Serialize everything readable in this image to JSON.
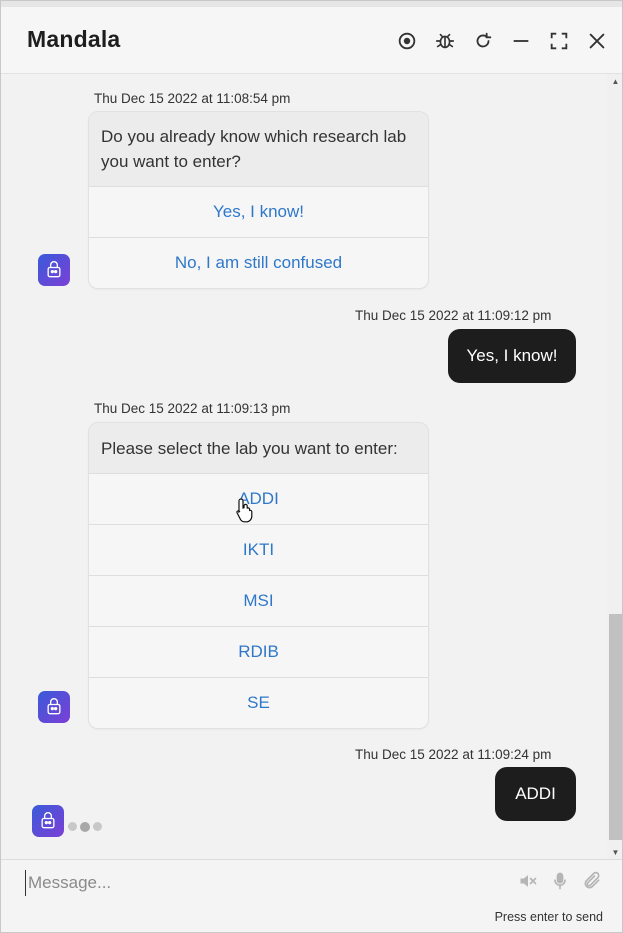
{
  "header": {
    "title": "Mandala",
    "icons": [
      "record-icon",
      "bug-icon",
      "refresh-icon",
      "minimize-icon",
      "fullscreen-icon",
      "close-icon"
    ]
  },
  "messages": {
    "m1": {
      "timestamp": "Thu Dec 15 2022 at 11:08:54 pm",
      "question": "Do you already know which research lab you want to enter?",
      "options": [
        "Yes, I know!",
        "No, I am still confused"
      ]
    },
    "m2": {
      "timestamp": "Thu Dec 15 2022 at 11:09:12 pm",
      "text": "Yes, I know!"
    },
    "m3": {
      "timestamp": "Thu Dec 15 2022 at 11:09:13 pm",
      "question": "Please select the lab you want to enter:",
      "options": [
        "ADDI",
        "IKTI",
        "MSI",
        "RDIB",
        "SE"
      ]
    },
    "m4": {
      "timestamp": "Thu Dec 15 2022 at 11:09:24 pm",
      "text": "ADDI"
    }
  },
  "footer": {
    "placeholder": "Message...",
    "hint": "Press enter to send",
    "icons": [
      "mute-icon",
      "microphone-icon",
      "attachment-icon"
    ]
  },
  "colors": {
    "accent_link": "#2f78c9",
    "user_bubble": "#1d1d1d",
    "avatar_gradient_start": "#3a5bd9",
    "avatar_gradient_end": "#7b3fd6"
  }
}
